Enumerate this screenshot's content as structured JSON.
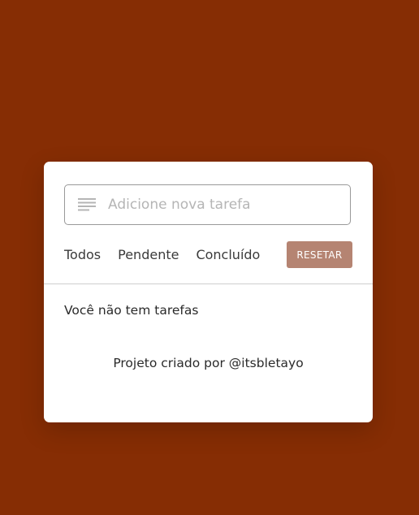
{
  "task_input": {
    "placeholder": "Adicione nova tarefa",
    "value": "",
    "icon": "lines-icon"
  },
  "filters": [
    {
      "label": "Todos"
    },
    {
      "label": "Pendente"
    },
    {
      "label": "Concluído"
    }
  ],
  "reset_button": {
    "label": "RESETAR"
  },
  "empty_message": "Você não tem tarefas",
  "credit": "Projeto criado por @itsbletayo",
  "colors": {
    "background": "#862d04",
    "card": "#ffffff",
    "reset_button": "#b58472"
  }
}
